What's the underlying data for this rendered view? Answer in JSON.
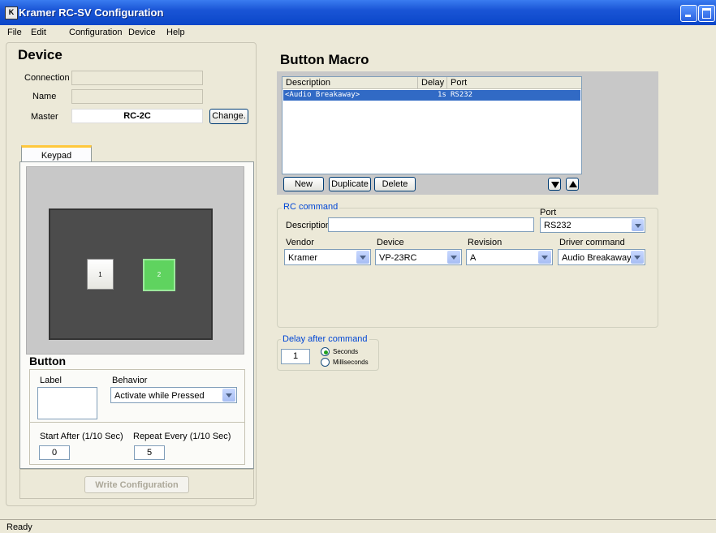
{
  "window": {
    "title": "Kramer RC-SV Configuration",
    "icon": "K"
  },
  "menu": [
    "File",
    "Edit",
    "Configuration",
    "Device",
    "Help"
  ],
  "device": {
    "heading": "Device",
    "connection_label": "Connection",
    "connection_value": "",
    "name_label": "Name",
    "name_value": "",
    "master_label": "Master",
    "master_value": "RC-2C",
    "change_button": "Change."
  },
  "keypad": {
    "tab_label": "Keypad",
    "keys": [
      {
        "label": "1",
        "selected": false
      },
      {
        "label": "2",
        "selected": true
      }
    ]
  },
  "button": {
    "heading": "Button",
    "label_label": "Label",
    "label_value": "",
    "behavior_label": "Behavior",
    "behavior_value": "Activate while Pressed",
    "start_after_label": "Start After (1/10 Sec)",
    "start_after_value": "0",
    "repeat_every_label": "Repeat Every (1/10 Sec)",
    "repeat_every_value": "5"
  },
  "write_button": "Write Configuration",
  "macro": {
    "heading": "Button Macro",
    "columns": [
      "Description",
      "Delay",
      "Port"
    ],
    "rows": [
      {
        "description": "<Audio Breakaway>",
        "delay": "1s",
        "port": "RS232"
      }
    ],
    "new_button": "New",
    "duplicate_button": "Duplicate",
    "delete_button": "Delete"
  },
  "rc_command": {
    "caption": "RC command",
    "description_label": "Description",
    "description_value": "",
    "port_label": "Port",
    "port_value": "RS232",
    "vendor_label": "Vendor",
    "vendor_value": "Kramer",
    "device_label": "Device",
    "device_value": "VP-23RC",
    "revision_label": "Revision",
    "revision_value": "A",
    "driver_label": "Driver command",
    "driver_value": "Audio Breakaway"
  },
  "delay": {
    "caption": "Delay after command",
    "value": "1",
    "seconds_label": "Seconds",
    "milliseconds_label": "Milliseconds",
    "unit_selected": "Seconds"
  },
  "status": "Ready",
  "colors": {
    "titlebar": "#0a46c8",
    "selection": "#316ac5",
    "key_selected": "#5fd35f",
    "groupcaption": "#0046d5"
  }
}
